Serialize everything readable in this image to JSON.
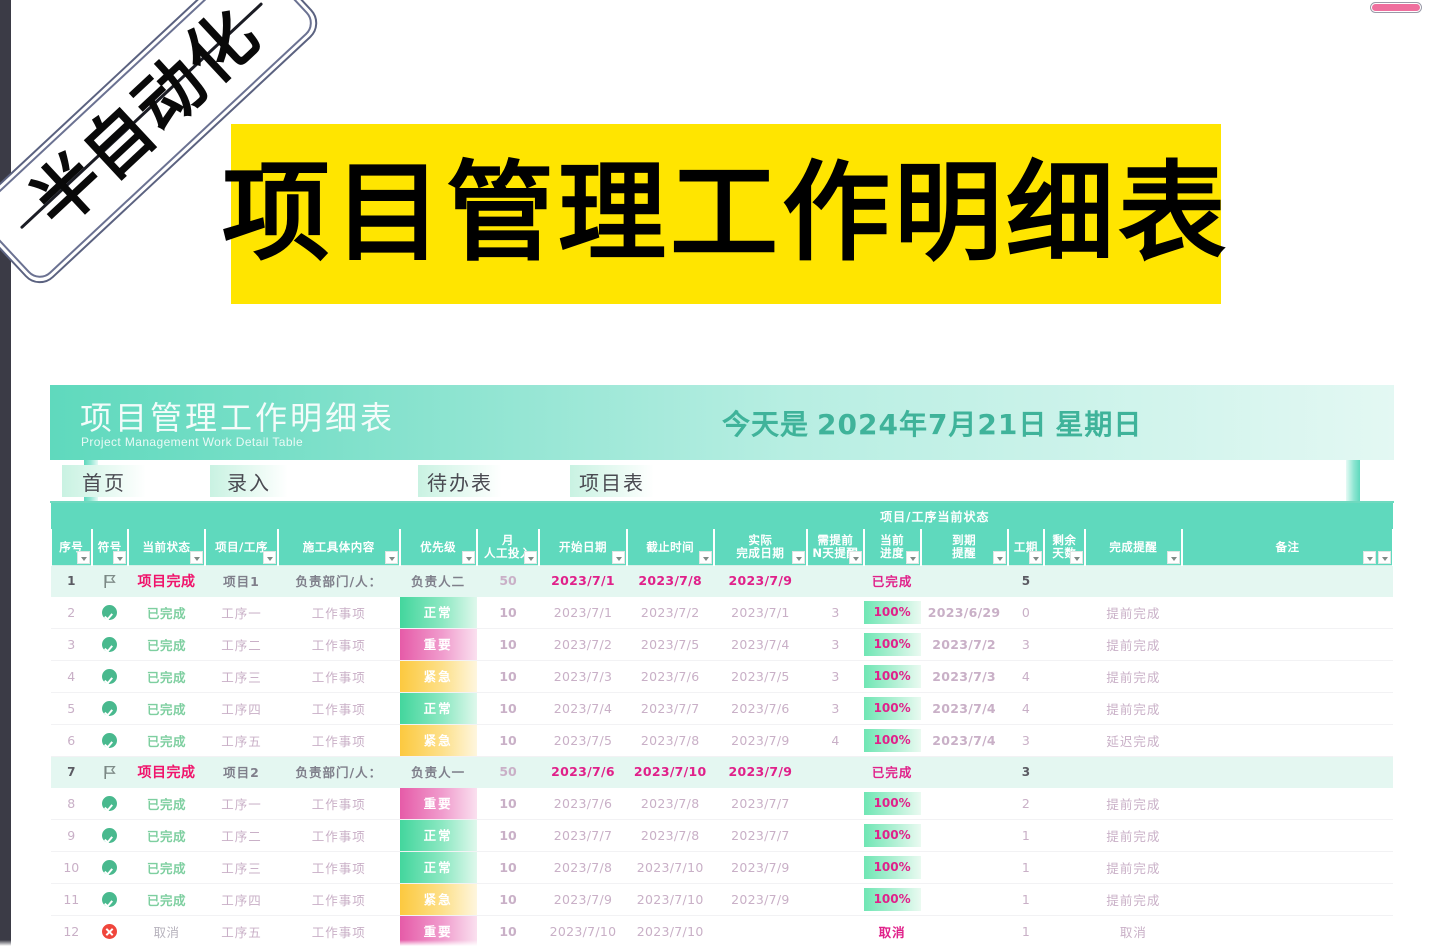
{
  "window": {
    "pill_indicator": "scroll-indicator",
    "accent_pink": "#ef6f9e",
    "edge_color": "#3b3b46"
  },
  "overlay": {
    "tablet_label": "半自动化",
    "marker_color": "#f05ba4"
  },
  "banner": {
    "title": "项目管理工作明细表",
    "bg_color": "#ffe500",
    "text_color": "#000000"
  },
  "sheet": {
    "title_cn": "项目管理工作明细表",
    "title_en": "Project Management Work Detail Table",
    "today_label": "今天是",
    "today_date": "2024年7月21日",
    "today_weekday": "星期日",
    "accent_teal": "#5fd9bd",
    "nav": [
      {
        "label": "首页"
      },
      {
        "label": "录入"
      },
      {
        "label": "待办表"
      },
      {
        "label": "项目表"
      }
    ],
    "group_header": "项目/工序当前状态",
    "columns": [
      {
        "key": "seq",
        "label": "序号",
        "filter": true
      },
      {
        "key": "symbol",
        "label": "符号",
        "filter": true
      },
      {
        "key": "status",
        "label": "当前状态",
        "filter": true
      },
      {
        "key": "proc",
        "label": "项目/工序",
        "filter": true
      },
      {
        "key": "content",
        "label": "施工具体内容",
        "filter": true
      },
      {
        "key": "prio",
        "label": "优先级",
        "filter": true
      },
      {
        "key": "labor",
        "label": "月\n人工投入",
        "filter": true
      },
      {
        "key": "start",
        "label": "开始日期",
        "filter": true
      },
      {
        "key": "deadline",
        "label": "截止时间",
        "filter": true
      },
      {
        "key": "actual",
        "label": "实际\n完成日期",
        "filter": true
      },
      {
        "key": "remind",
        "label": "需提前\nN天提醒",
        "filter": true
      },
      {
        "key": "progress",
        "label": "当前\n进度",
        "filter": true
      },
      {
        "key": "due",
        "label": "到期\n提醒",
        "filter": true
      },
      {
        "key": "dur",
        "label": "工期",
        "filter": true
      },
      {
        "key": "left",
        "label": "剩余\n天数",
        "filter": true
      },
      {
        "key": "finish",
        "label": "完成提醒",
        "filter": true
      },
      {
        "key": "note",
        "label": "备注",
        "filter": true
      }
    ],
    "rows": [
      {
        "type": "project",
        "seq": "1",
        "symbol": "flag-icon",
        "status": "项目完成",
        "proc": "项目1",
        "content": "负责部门/人：",
        "prio": "负责人二",
        "prio_style": "",
        "labor": "50",
        "start": "2023/7/1",
        "deadline": "2023/7/8",
        "actual": "2023/7/9",
        "remind": "",
        "progress": "已完成",
        "progress_style": "plain",
        "due": "",
        "dur": "5",
        "left": "",
        "finish": "",
        "note": ""
      },
      {
        "type": "task",
        "seq": "2",
        "symbol": "check-icon",
        "status": "已完成",
        "proc": "工序一",
        "content": "工作事项",
        "prio": "正常",
        "prio_style": "normal",
        "labor": "10",
        "start": "2023/7/1",
        "deadline": "2023/7/2",
        "actual": "2023/7/1",
        "remind": "3",
        "progress": "100%",
        "progress_style": "bar",
        "due": "2023/6/29",
        "dur": "0",
        "left": "",
        "finish": "提前完成",
        "note": ""
      },
      {
        "type": "task",
        "seq": "3",
        "symbol": "check-icon",
        "status": "已完成",
        "proc": "工序二",
        "content": "工作事项",
        "prio": "重要",
        "prio_style": "important",
        "labor": "10",
        "start": "2023/7/2",
        "deadline": "2023/7/5",
        "actual": "2023/7/4",
        "remind": "3",
        "progress": "100%",
        "progress_style": "bar",
        "due": "2023/7/2",
        "dur": "3",
        "left": "",
        "finish": "提前完成",
        "note": ""
      },
      {
        "type": "task",
        "seq": "4",
        "symbol": "check-icon",
        "status": "已完成",
        "proc": "工序三",
        "content": "工作事项",
        "prio": "紧急",
        "prio_style": "urgent",
        "labor": "10",
        "start": "2023/7/3",
        "deadline": "2023/7/6",
        "actual": "2023/7/5",
        "remind": "3",
        "progress": "100%",
        "progress_style": "bar",
        "due": "2023/7/3",
        "dur": "4",
        "left": "",
        "finish": "提前完成",
        "note": ""
      },
      {
        "type": "task",
        "seq": "5",
        "symbol": "check-icon",
        "status": "已完成",
        "proc": "工序四",
        "content": "工作事项",
        "prio": "正常",
        "prio_style": "normal",
        "labor": "10",
        "start": "2023/7/4",
        "deadline": "2023/7/7",
        "actual": "2023/7/6",
        "remind": "3",
        "progress": "100%",
        "progress_style": "bar",
        "due": "2023/7/4",
        "dur": "4",
        "left": "",
        "finish": "提前完成",
        "note": ""
      },
      {
        "type": "task",
        "seq": "6",
        "symbol": "check-icon",
        "status": "已完成",
        "proc": "工序五",
        "content": "工作事项",
        "prio": "紧急",
        "prio_style": "urgent",
        "labor": "10",
        "start": "2023/7/5",
        "deadline": "2023/7/8",
        "actual": "2023/7/9",
        "remind": "4",
        "progress": "100%",
        "progress_style": "bar",
        "due": "2023/7/4",
        "dur": "3",
        "left": "",
        "finish": "延迟完成",
        "note": ""
      },
      {
        "type": "project",
        "seq": "7",
        "symbol": "flag-icon",
        "status": "项目完成",
        "proc": "项目2",
        "content": "负责部门/人：",
        "prio": "负责人一",
        "prio_style": "",
        "labor": "50",
        "start": "2023/7/6",
        "deadline": "2023/7/10",
        "actual": "2023/7/9",
        "remind": "",
        "progress": "已完成",
        "progress_style": "plain",
        "due": "",
        "dur": "3",
        "left": "",
        "finish": "",
        "note": ""
      },
      {
        "type": "task",
        "seq": "8",
        "symbol": "check-icon",
        "status": "已完成",
        "proc": "工序一",
        "content": "工作事项",
        "prio": "重要",
        "prio_style": "important",
        "labor": "10",
        "start": "2023/7/6",
        "deadline": "2023/7/8",
        "actual": "2023/7/7",
        "remind": "",
        "progress": "100%",
        "progress_style": "bar",
        "due": "",
        "dur": "2",
        "left": "",
        "finish": "提前完成",
        "note": ""
      },
      {
        "type": "task",
        "seq": "9",
        "symbol": "check-icon",
        "status": "已完成",
        "proc": "工序二",
        "content": "工作事项",
        "prio": "正常",
        "prio_style": "normal",
        "labor": "10",
        "start": "2023/7/7",
        "deadline": "2023/7/8",
        "actual": "2023/7/7",
        "remind": "",
        "progress": "100%",
        "progress_style": "bar",
        "due": "",
        "dur": "1",
        "left": "",
        "finish": "提前完成",
        "note": ""
      },
      {
        "type": "task",
        "seq": "10",
        "symbol": "check-icon",
        "status": "已完成",
        "proc": "工序三",
        "content": "工作事项",
        "prio": "正常",
        "prio_style": "normal",
        "labor": "10",
        "start": "2023/7/8",
        "deadline": "2023/7/10",
        "actual": "2023/7/9",
        "remind": "",
        "progress": "100%",
        "progress_style": "bar",
        "due": "",
        "dur": "1",
        "left": "",
        "finish": "提前完成",
        "note": ""
      },
      {
        "type": "task",
        "seq": "11",
        "symbol": "check-icon",
        "status": "已完成",
        "proc": "工序四",
        "content": "工作事项",
        "prio": "紧急",
        "prio_style": "urgent",
        "labor": "10",
        "start": "2023/7/9",
        "deadline": "2023/7/10",
        "actual": "2023/7/9",
        "remind": "",
        "progress": "100%",
        "progress_style": "bar",
        "due": "",
        "dur": "1",
        "left": "",
        "finish": "提前完成",
        "note": ""
      },
      {
        "type": "task",
        "seq": "12",
        "symbol": "x-icon",
        "status": "取消",
        "proc": "工序五",
        "content": "工作事项",
        "prio": "重要",
        "prio_style": "important",
        "labor": "10",
        "start": "2023/7/10",
        "deadline": "2023/7/10",
        "actual": "",
        "remind": "",
        "progress": "取消",
        "progress_style": "plain",
        "due": "",
        "dur": "1",
        "left": "",
        "finish": "取消",
        "note": ""
      }
    ]
  }
}
